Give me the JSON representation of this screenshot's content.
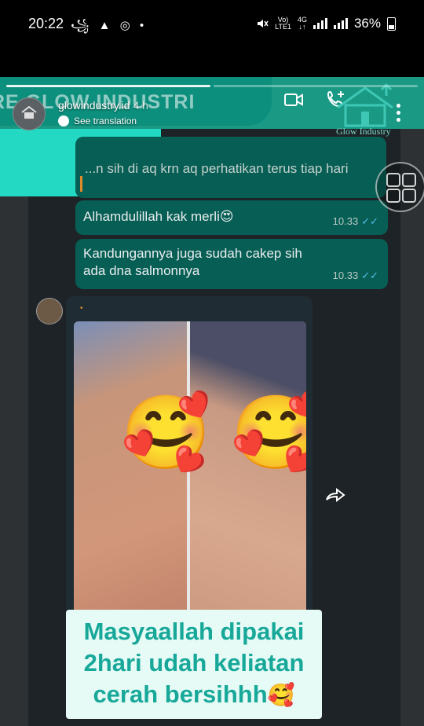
{
  "status_bar": {
    "time": "20:22",
    "left_icons": "꧁ ▲ ◎ •",
    "network_top": "Vo)",
    "network_bottom": "LTE1",
    "net_type_top": "4G",
    "net_type_bottom": "↓↑",
    "battery": "36%",
    "icons": [
      "mute-icon",
      "signal-icon",
      "battery-icon"
    ]
  },
  "story": {
    "account_name": "glowindustry.id",
    "account_time": "4 h",
    "see_translation": "See translation"
  },
  "chat_header": {
    "title": "RE GLOW INDUSTRI",
    "brand_text": "Glow Industry"
  },
  "messages": [
    {
      "text": "...n sih di aq krn aq perhatikan terus tiap hari",
      "time": ""
    },
    {
      "text": "Alhamdulillah kak merli😍",
      "time": "10.33",
      "ticks": "✓✓"
    },
    {
      "text": "Kandungannya juga sudah cakep sih ada dna salmonnya",
      "time": "10.33",
      "ticks": "✓✓"
    }
  ],
  "photo_emojis": [
    "🥰",
    "🥰"
  ],
  "caption": {
    "line1": "Masyaallah dipakai",
    "line2": "2hari udah keliatan",
    "line3": "cerah bersihhh",
    "emoji": "🥰"
  },
  "colors": {
    "teal": "#23d9c4",
    "header_green": "#1a9a85",
    "bubble_green": "#075e54",
    "caption_text": "#18a89a",
    "read_tick": "#53bdeb"
  }
}
